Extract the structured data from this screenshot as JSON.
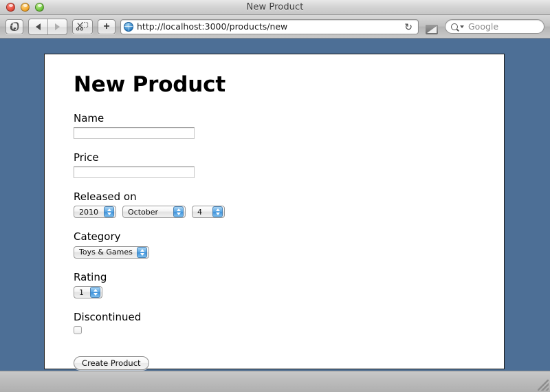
{
  "window": {
    "title": "New Product",
    "traffic_lights": [
      {
        "name": "close",
        "color": "#e24b3b"
      },
      {
        "name": "minimize",
        "color": "#f2a62a"
      },
      {
        "name": "zoom",
        "color": "#68c139"
      }
    ]
  },
  "toolbar": {
    "evernote_icon": "evernote-elephant-icon",
    "back_icon": "back-arrow-icon",
    "forward_icon": "forward-arrow-icon",
    "clip_icon": "scissors-clip-icon",
    "add_label": "+",
    "favicon": "globe-icon",
    "url": "http://localhost:3000/products/new",
    "reload_glyph": "↻",
    "downloads_icon": "downloads-tray-icon",
    "search_icon": "magnifier-icon",
    "search_placeholder": "Google",
    "search_value": ""
  },
  "page": {
    "heading": "New Product",
    "fields": {
      "name": {
        "label": "Name",
        "value": "",
        "placeholder": ""
      },
      "price": {
        "label": "Price",
        "value": "",
        "placeholder": ""
      },
      "released_on": {
        "label": "Released on",
        "year": "2010",
        "month": "October",
        "day": "4"
      },
      "category": {
        "label": "Category",
        "value": "Toys & Games"
      },
      "rating": {
        "label": "Rating",
        "value": "1"
      },
      "discontinued": {
        "label": "Discontinued",
        "checked": false
      }
    },
    "submit_label": "Create Product"
  },
  "colors": {
    "desktop_blue": "#4d6f96",
    "aqua_blue": "#5aa7e4"
  }
}
